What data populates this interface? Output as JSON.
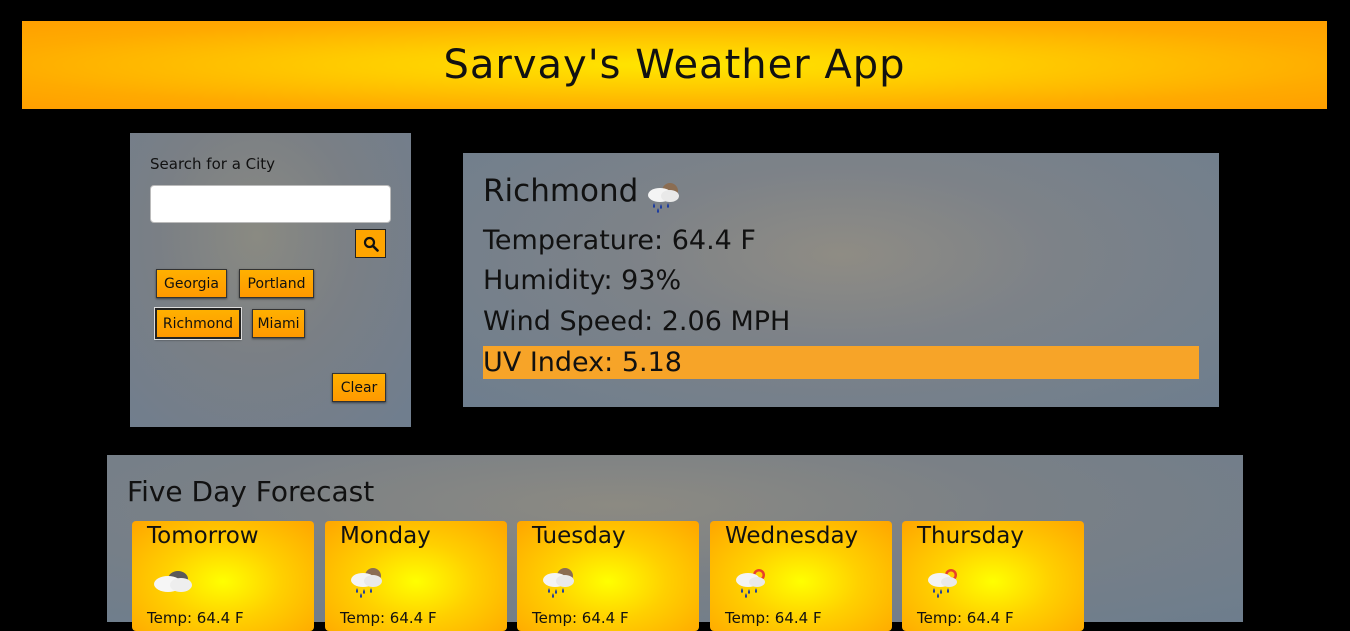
{
  "header": {
    "title": "Sarvay's Weather App"
  },
  "search": {
    "label": "Search for a City",
    "input_value": "",
    "placeholder": "",
    "search_icon": "search-icon",
    "history": [
      "Georgia",
      "Portland",
      "Richmond",
      "Miami"
    ],
    "active_city": "Richmond",
    "clear_label": "Clear"
  },
  "current": {
    "city": "Richmond",
    "icon": "rain-cloud-icon",
    "temperature": "Temperature: 64.4 F",
    "humidity": "Humidity: 93%",
    "wind": "Wind Speed: 2.06 MPH",
    "uv": "UV Index: 5.18",
    "uv_color": "#f7a428"
  },
  "forecast": {
    "title": "Five Day Forecast",
    "days": [
      {
        "name": "Tomorrow",
        "icon": "cloud-icon",
        "temp": "Temp: 64.4 F"
      },
      {
        "name": "Monday",
        "icon": "rain-cloud-icon",
        "temp": "Temp: 64.4 F"
      },
      {
        "name": "Tuesday",
        "icon": "rain-cloud-icon",
        "temp": "Temp: 64.4 F"
      },
      {
        "name": "Wednesday",
        "icon": "sun-rain-icon",
        "temp": "Temp: 64.4 F"
      },
      {
        "name": "Thursday",
        "icon": "sun-rain-icon",
        "temp": "Temp: 64.4 F"
      }
    ]
  },
  "colors": {
    "background": "#000000",
    "accent": "#ffa500",
    "panel": "#77808a"
  }
}
